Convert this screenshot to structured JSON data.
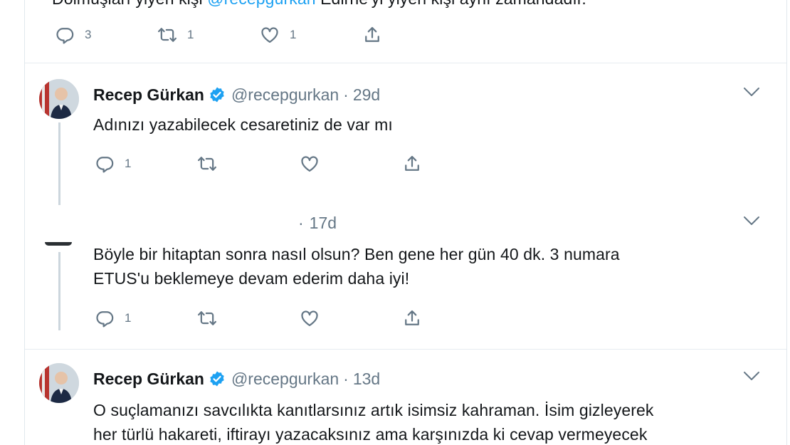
{
  "top_tweet": {
    "text_before": "Dolmuşları yiyen kişi ",
    "mention": "@recepgurkan",
    "text_after": " Edirne'yi yiyen kişi aynı zamandadır.",
    "reply_count": "3",
    "retweet_count": "1",
    "like_count": "1"
  },
  "tweets": [
    {
      "name": "Recep Gürkan",
      "handle": "@recepgurkan",
      "dot": "·",
      "time": "29d",
      "text_lines": [
        "Adınızı yazabilecek cesaretiniz de var mı"
      ],
      "reply_count": "1",
      "retweet_count": "",
      "like_count": ""
    },
    {
      "name": "",
      "handle": "",
      "dot": "·",
      "time": "17d",
      "text_lines": [
        "Böyle bir hitaptan sonra nasıl olsun? Ben gene her gün 40 dk. 3 numara",
        "ETUS'u beklemeye devam ederim daha iyi!"
      ],
      "reply_count": "1",
      "retweet_count": "",
      "like_count": ""
    },
    {
      "name": "Recep Gürkan",
      "handle": "@recepgurkan",
      "dot": "·",
      "time": "13d",
      "text_lines": [
        "O suçlamanızı savcılıkta kanıtlarsınız artık isimsiz kahraman. İsim gizleyerek",
        "her türlü hakareti, iftirayı yazacaksınız ama karşınızda ki cevap vermeyecek"
      ]
    }
  ],
  "colors": {
    "link": "#1da1f2",
    "muted": "#657786",
    "verified": "#1da1f2",
    "line": "#ccd6dd"
  },
  "icons": [
    "reply-icon",
    "retweet-icon",
    "like-icon",
    "share-icon",
    "chevron-down-icon",
    "verified-badge-icon"
  ]
}
